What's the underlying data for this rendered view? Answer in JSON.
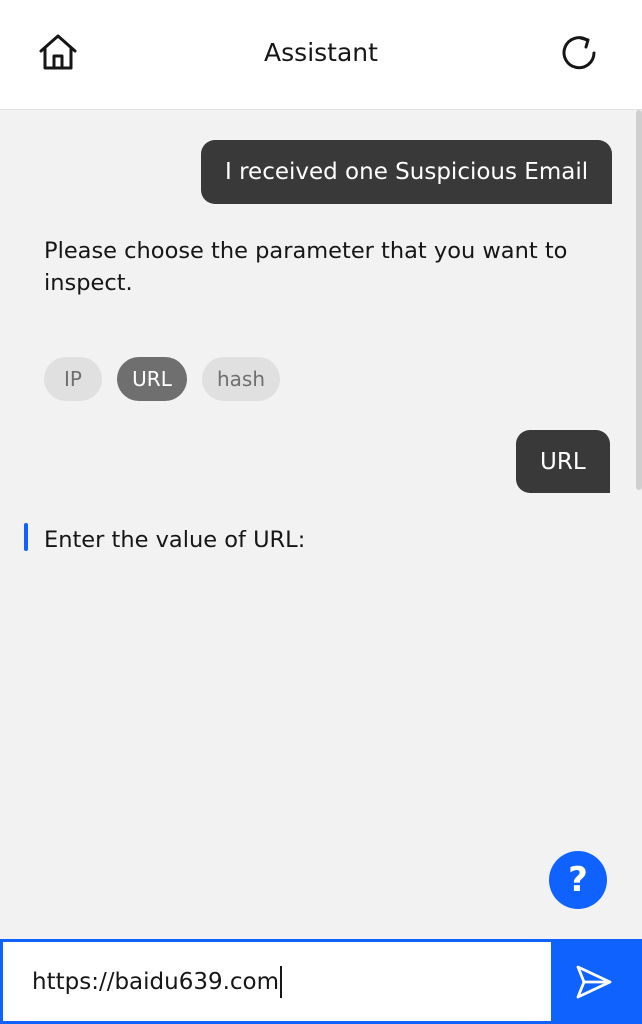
{
  "header": {
    "title": "Assistant",
    "home_icon": "home-icon",
    "refresh_icon": "refresh-icon"
  },
  "conversation": {
    "user_message_1": "I received one Suspicious Email",
    "bot_prompt_1": "Please choose the parameter that you want to inspect.",
    "options": [
      {
        "label": "IP",
        "selected": false
      },
      {
        "label": "URL",
        "selected": true
      },
      {
        "label": "hash",
        "selected": false
      }
    ],
    "user_message_2": "URL",
    "bot_prompt_2": "Enter the value of URL:"
  },
  "help": {
    "label": "?"
  },
  "input": {
    "value": "https://baidu639.com",
    "send_icon": "send-icon"
  },
  "colors": {
    "accent": "#0f62fe",
    "user_bubble": "#393939",
    "background": "#f2f2f2",
    "chip_selected": "#6f6f6f",
    "chip_unselected": "#e0e0e0"
  }
}
